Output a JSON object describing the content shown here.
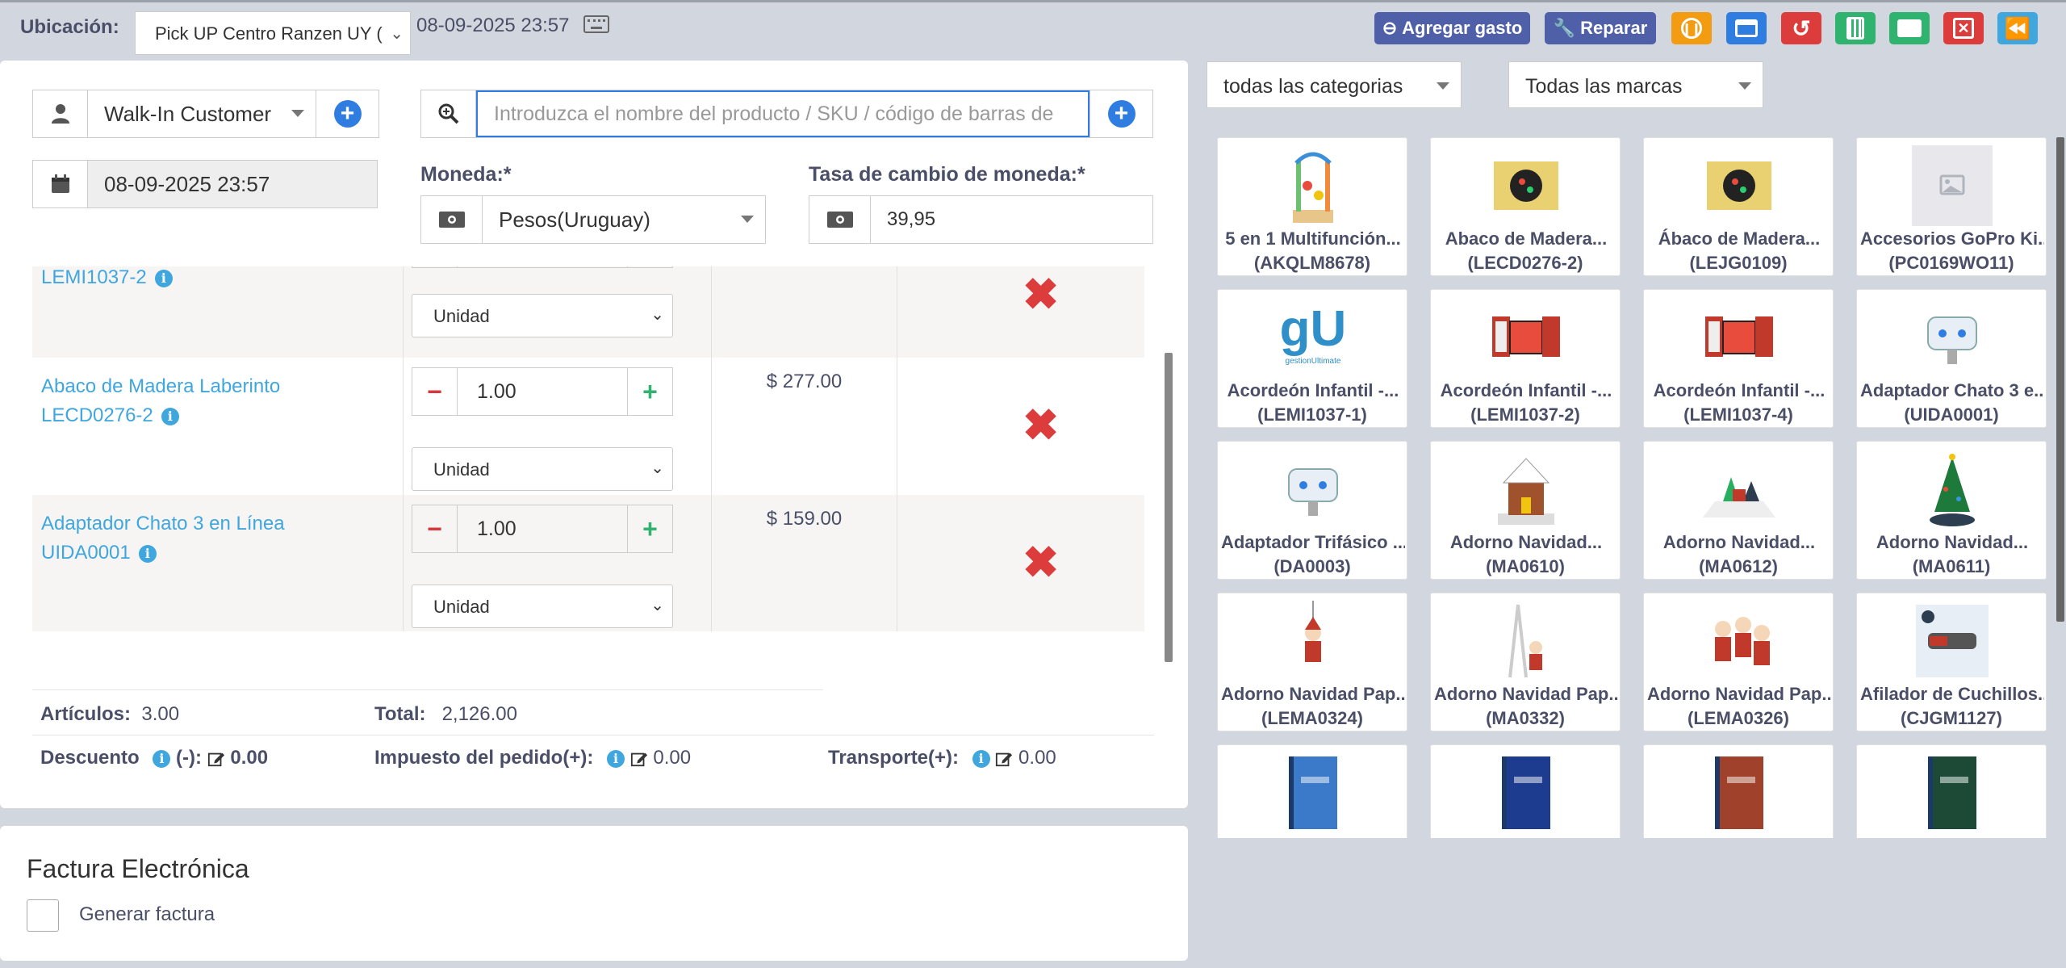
{
  "topbar": {
    "location_label": "Ubicación:",
    "location_value": "Pick UP Centro Ranzen UY (",
    "datetime": "08-09-2025 23:57",
    "add_expense_label": "Agregar gasto",
    "repair_label": "Reparar"
  },
  "customer": {
    "value": "Walk-In Customer"
  },
  "search": {
    "placeholder": "Introduzca el nombre del producto / SKU / código de barras de"
  },
  "date_field": {
    "value": "08-09-2025 23:57"
  },
  "currency": {
    "label": "Moneda:*",
    "value": "Pesos(Uruguay)"
  },
  "exchange_rate": {
    "label": "Tasa de cambio de moneda:*",
    "value": "39,95"
  },
  "cart_rows": [
    {
      "name": "",
      "sku": "LEMI1037-2",
      "qty": "",
      "unit": "Unidad",
      "price": ""
    },
    {
      "name": "Abaco de Madera Laberinto",
      "sku": "LECD0276-2",
      "qty": "1.00",
      "unit": "Unidad",
      "price": "$ 277.00"
    },
    {
      "name": "Adaptador Chato 3 en Línea",
      "sku": "UIDA0001",
      "qty": "1.00",
      "unit": "Unidad",
      "price": "$ 159.00"
    }
  ],
  "summary": {
    "items_label": "Artículos:",
    "items_value": "3.00",
    "total_label": "Total:",
    "total_value": "2,126.00",
    "discount_label": "Descuento",
    "discount_sign": "(-):",
    "discount_value": "0.00",
    "tax_label": "Impuesto del pedido(+):",
    "tax_value": "0.00",
    "shipping_label": "Transporte(+):",
    "shipping_value": "0.00"
  },
  "invoice": {
    "title": "Factura Electrónica",
    "checkbox_label": "Generar factura"
  },
  "filters": {
    "category": "todas las categorias",
    "brand": "Todas las marcas"
  },
  "products": [
    {
      "name": "5 en 1 Multifunción...",
      "sku": "(AKQLM8678)",
      "icon": "toy-icon"
    },
    {
      "name": "Abaco de Madera...",
      "sku": "(LECD0276-2)",
      "icon": "abacus-icon"
    },
    {
      "name": "Ábaco de Madera...",
      "sku": "(LEJG0109)",
      "icon": "abacus-icon"
    },
    {
      "name": "Accesorios GoPro Ki...",
      "sku": "(PC0169WO11)",
      "icon": "image-placeholder-icon"
    },
    {
      "name": "Acordeón Infantil -...",
      "sku": "(LEMI1037-1)",
      "icon": "logo-icon"
    },
    {
      "name": "Acordeón Infantil -...",
      "sku": "(LEMI1037-2)",
      "icon": "accordion-icon"
    },
    {
      "name": "Acordeón Infantil -...",
      "sku": "(LEMI1037-4)",
      "icon": "accordion-icon"
    },
    {
      "name": "Adaptador Chato 3 e...",
      "sku": "(UIDA0001)",
      "icon": "adapter-icon"
    },
    {
      "name": "Adaptador Trifásico ...",
      "sku": "(DA0003)",
      "icon": "adapter-icon"
    },
    {
      "name": "Adorno Navidad...",
      "sku": "(MA0610)",
      "icon": "christmas-house-icon"
    },
    {
      "name": "Adorno Navidad...",
      "sku": "(MA0612)",
      "icon": "christmas-village-icon"
    },
    {
      "name": "Adorno Navidad...",
      "sku": "(MA0611)",
      "icon": "christmas-tree-icon"
    },
    {
      "name": "Adorno Navidad Pap...",
      "sku": "(LEMA0324)",
      "icon": "santa-icon"
    },
    {
      "name": "Adorno Navidad Pap...",
      "sku": "(MA0332)",
      "icon": "santa-ladder-icon"
    },
    {
      "name": "Adorno Navidad Pap...",
      "sku": "(LEMA0326)",
      "icon": "santa-group-icon"
    },
    {
      "name": "Afilador de Cuchillos...",
      "sku": "(CJGM1127)",
      "icon": "knife-sharpener-icon"
    },
    {
      "name": "",
      "sku": "",
      "icon": "notebook-icon"
    },
    {
      "name": "",
      "sku": "",
      "icon": "notebook-icon"
    },
    {
      "name": "",
      "sku": "",
      "icon": "notebook-icon"
    },
    {
      "name": "",
      "sku": "",
      "icon": "notebook-icon"
    }
  ],
  "colors": {
    "accent": "#2f7de1",
    "link": "#3fa6de",
    "danger": "#dd3c3c",
    "success": "#2fb36e"
  }
}
